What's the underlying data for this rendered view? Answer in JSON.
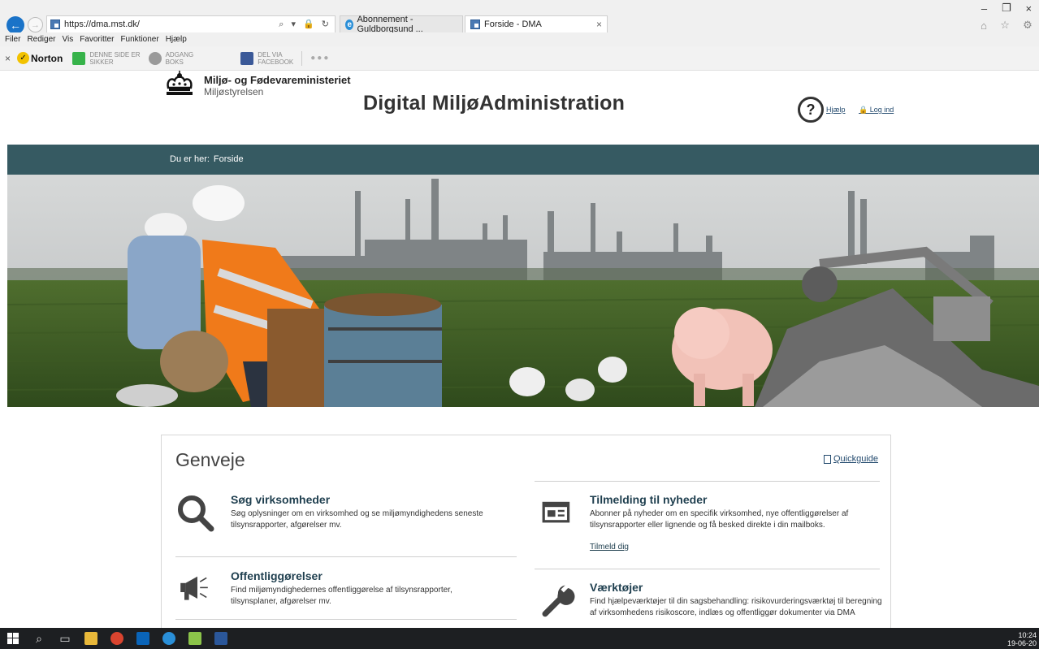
{
  "browser": {
    "url": "https://dma.mst.dk/",
    "tabs": [
      {
        "label": "Abonnement - Guldborgsund ..."
      },
      {
        "label": "Forside - DMA"
      }
    ],
    "menu": [
      "Filer",
      "Rediger",
      "Vis",
      "Favoritter",
      "Funktioner",
      "Hjælp"
    ],
    "toolbar": {
      "norton_label": "Norton",
      "safe_line1": "DENNE SIDE ER",
      "safe_line2": "SIKKER",
      "access_line1": "ADGANG",
      "access_line2": "BOKS",
      "share_line1": "DEL VIA",
      "share_line2": "FACEBOOK",
      "more": "●●●"
    },
    "tab_close": "×",
    "window_controls": [
      "–",
      "❐",
      "×"
    ],
    "right_tools": [
      "⌂",
      "☆",
      "⚙"
    ]
  },
  "header": {
    "ministry": "Miljø- og Fødevareministeriet",
    "agency": "Miljøstyrelsen",
    "site_title": "Digital MiljøAdministration",
    "help_symbol": "?",
    "help_label": "Hjælp",
    "login_label": "🔒 Log ind"
  },
  "breadcrumb": {
    "prefix": "Du er her:",
    "current": "Forside"
  },
  "shortcuts": {
    "title": "Genveje",
    "quickguide_label": "Quickguide",
    "items": [
      {
        "title": "Søg virksomheder",
        "description": "Søg oplysninger om en virksomhed og se miljømyndighedens seneste tilsynsrapporter, afgørelser mv.",
        "icon": "magnifier-icon"
      },
      {
        "title": "Tilmelding til nyheder",
        "description": "Abonner på nyheder om en specifik virksomhed, nye offentliggørelser af tilsynsrapporter eller lignende og få besked direkte i din mailboks.",
        "link": "Tilmeld dig",
        "icon": "newspaper-icon"
      },
      {
        "title": "Offentliggørelser",
        "description": "Find miljømyndighedernes offentliggørelse af tilsynsrapporter, tilsynsplaner, afgørelser mv.",
        "icon": "megaphone-icon"
      },
      {
        "title": "Værktøjer",
        "description": "Find hjælpeværktøjer til din sagsbehandling: risikovurderingsværktøj til beregning af virksomhedens risikoscore, indlæs og offentliggør dokumenter via DMA",
        "icon": "wrench-icon"
      }
    ]
  },
  "taskbar": {
    "time": "10:24",
    "date": "19-06-20"
  },
  "colors": {
    "breadcrumb_bar": "#365a62",
    "heading": "#1f3f4f",
    "link": "#234a6e"
  }
}
